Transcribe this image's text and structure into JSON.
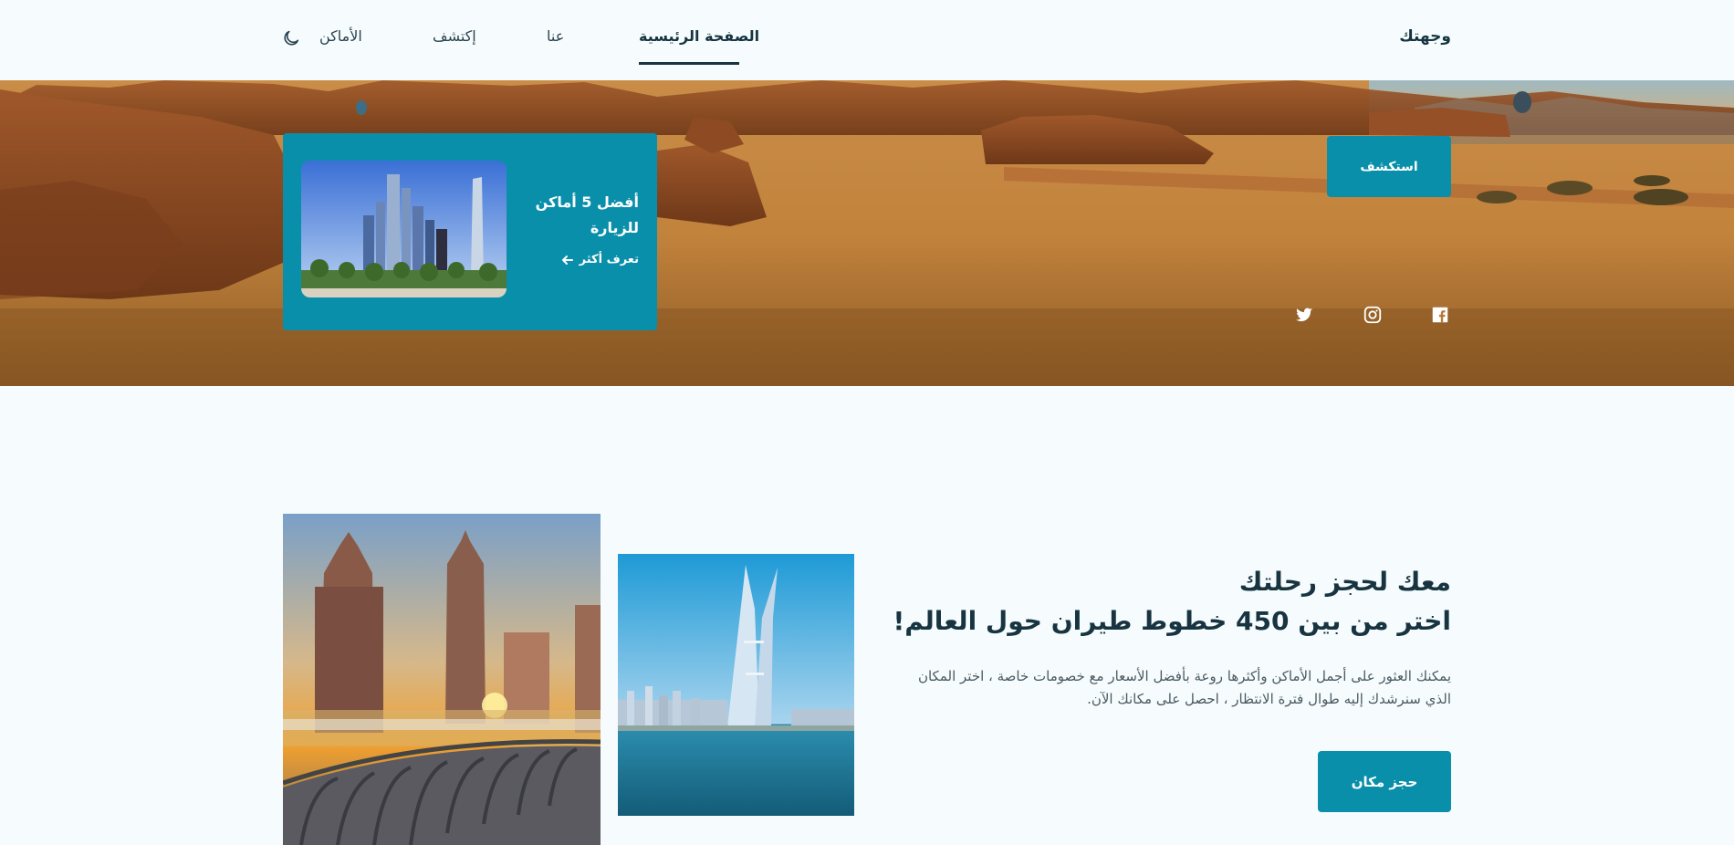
{
  "header": {
    "brand": "وجهتك",
    "nav": [
      {
        "label": "الصفحة الرئيسية",
        "active": true
      },
      {
        "label": "عنا"
      },
      {
        "label": "إكتشف"
      },
      {
        "label": "الأماكن"
      }
    ],
    "theme_icon": "moon-icon"
  },
  "hero": {
    "explore_label": "استكشف",
    "featured": {
      "title": "أفضل 5 أماكن للزيارة",
      "link_label": "تعرف أكثر",
      "link_icon": "arrow-left-icon"
    },
    "social_icons": [
      "facebook-icon",
      "instagram-icon",
      "twitter-icon"
    ]
  },
  "booking": {
    "headline_line1": "معك لحجز رحلتك",
    "headline_line2": "اختر من بين 450 خطوط طيران حول العالم!",
    "description": "يمكنك العثور على أجمل الأماكن وأكثرها روعة بأفضل الأسعار مع خصومات خاصة ، اختر المكان الذي سنرشدك إليه طوال فترة الانتظار ، احصل على مكانك الآن.",
    "cta_label": "حجز مكان"
  },
  "colors": {
    "accent": "#0a8fab",
    "heading": "#173440",
    "background": "#f6fcfd"
  }
}
